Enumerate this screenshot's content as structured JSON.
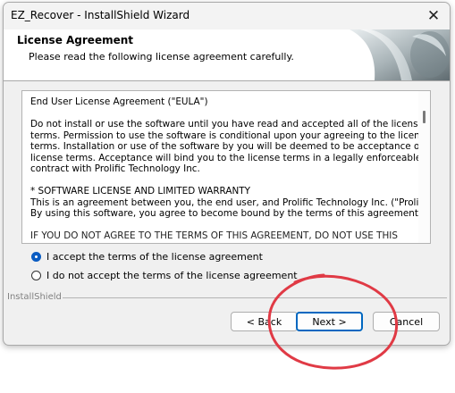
{
  "window": {
    "title": "EZ_Recover - InstallShield Wizard"
  },
  "header": {
    "title": "License Agreement",
    "subtitle": "Please read the following license agreement carefully."
  },
  "eula": {
    "paragraphs": [
      [
        "End User License Agreement (\"EULA\")"
      ],
      [
        "Do not install or use the software until you have read and accepted all of the license",
        "terms. Permission to use the software is conditional upon your agreeing to the license",
        "terms. Installation or use of the software by you will be deemed to be acceptance of the",
        "license terms. Acceptance will bind you to the license terms in a legally enforceable",
        "contract with Prolific Technology Inc."
      ],
      [
        "* SOFTWARE LICENSE AND LIMITED WARRANTY",
        "This is an agreement between you, the end user, and Prolific Technology Inc. (\"Prolific\").",
        "By using this software, you agree to become bound by the terms of this agreement."
      ],
      [
        "IF YOU DO NOT AGREE TO THE TERMS OF THIS AGREEMENT, DO NOT USE THIS"
      ]
    ]
  },
  "options": {
    "accept": "I accept the terms of the license agreement",
    "decline": "I do not accept the terms of the license agreement",
    "selected": "accept"
  },
  "footer": {
    "group_label": "InstallShield",
    "back": "< Back",
    "next": "Next >",
    "cancel": "Cancel"
  },
  "annotation": {
    "color": "#e03a45"
  }
}
